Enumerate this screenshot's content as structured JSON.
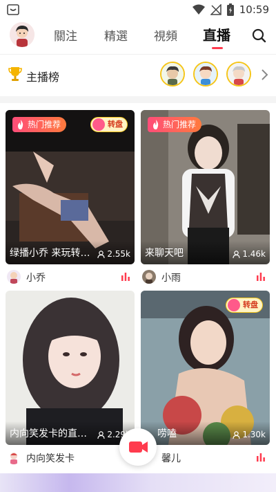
{
  "status_bar": {
    "time": "10:59"
  },
  "nav": {
    "tabs": [
      {
        "label": "關注",
        "active": false
      },
      {
        "label": "精選",
        "active": false
      },
      {
        "label": "視頻",
        "active": false
      },
      {
        "label": "直播",
        "active": true
      }
    ],
    "accent_color": "#ff3b4e"
  },
  "leaderboard": {
    "title": "主播榜"
  },
  "cards": [
    {
      "hot_label": "热门推荐",
      "wheel_label": "转盘",
      "title": "绿播小乔 来玩转…",
      "viewers": "2.55k",
      "streamer": "小乔"
    },
    {
      "hot_label": "热门推荐",
      "wheel_label": "",
      "title": "来聊天吧",
      "viewers": "1.46k",
      "streamer": "小雨"
    },
    {
      "hot_label": "",
      "wheel_label": "",
      "title": "内向笑发卡的直…",
      "viewers": "2.29k",
      "streamer": "内向笑发卡"
    },
    {
      "hot_label": "",
      "wheel_label": "转盘",
      "title": "唠嗑",
      "viewers": "1.30k",
      "streamer": "馨儿"
    }
  ],
  "colors": {
    "hot_badge": "#ff4d79",
    "wheel_badge_bg": "#fff3c4",
    "live_bars": "#ff3b4e"
  }
}
